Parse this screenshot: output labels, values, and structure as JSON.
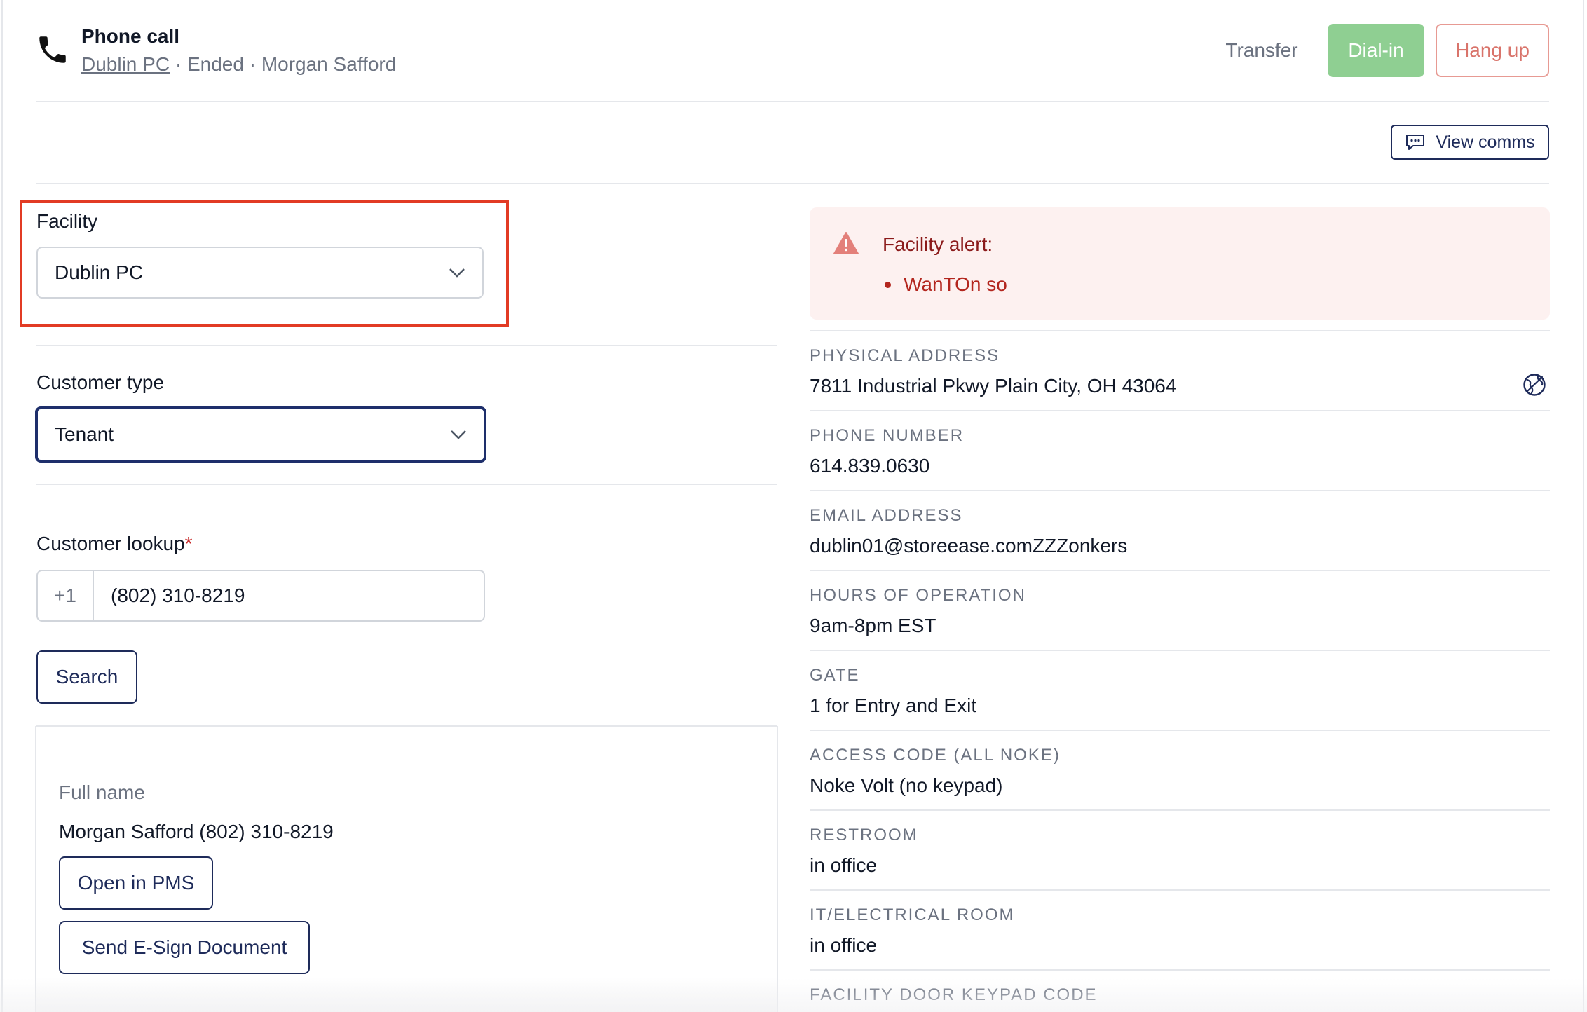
{
  "header": {
    "title": "Phone call",
    "facility_link": "Dublin PC",
    "separator1": " · ",
    "status": "Ended",
    "separator2": " · ",
    "caller": "Morgan Safford",
    "transfer_label": "Transfer",
    "dial_in_label": "Dial-in",
    "hang_up_label": "Hang up"
  },
  "toolbar": {
    "view_comms_label": "View comms"
  },
  "form": {
    "facility": {
      "label": "Facility",
      "value": "Dublin PC"
    },
    "customer_type": {
      "label": "Customer type",
      "value": "Tenant"
    },
    "customer_lookup": {
      "label": "Customer lookup",
      "required_mark": "*",
      "country_code": "+1",
      "phone_value": "(802) 310-8219",
      "search_label": "Search"
    }
  },
  "result": {
    "full_name_label": "Full name",
    "full_name_value": "Morgan Safford (802) 310-8219",
    "open_pms_label": "Open in PMS",
    "send_esign_label": "Send E-Sign Document"
  },
  "alert": {
    "title": "Facility alert:",
    "items": [
      "WanTOn so"
    ]
  },
  "facility_info": [
    {
      "label": "PHYSICAL ADDRESS",
      "value": "7811 Industrial Pkwy Plain City, OH 43064"
    },
    {
      "label": "PHONE NUMBER",
      "value": "614.839.0630"
    },
    {
      "label": "EMAIL ADDRESS",
      "value": "dublin01@storeease.comZZZonkers"
    },
    {
      "label": "HOURS OF OPERATION",
      "value": "9am-8pm EST"
    },
    {
      "label": "GATE",
      "value": "1 for Entry and Exit"
    },
    {
      "label": "ACCESS CODE (ALL NOKE)",
      "value": "Noke Volt (no keypad)"
    },
    {
      "label": "RESTROOM",
      "value": "in office"
    },
    {
      "label": "IT/ELECTRICAL ROOM",
      "value": "in office"
    },
    {
      "label": "FACILITY DOOR KEYPAD CODE",
      "value": ""
    }
  ],
  "colors": {
    "accent_navy": "#1e2b5a",
    "dial_in_green": "#8fcf92",
    "hang_up_red": "#d9746b",
    "alert_bg": "#fdf1f0",
    "highlight_red": "#e23b24"
  },
  "icons": [
    "phone-icon",
    "chevron-down-icon",
    "chat-bubble-icon",
    "warning-icon",
    "globe-icon"
  ]
}
